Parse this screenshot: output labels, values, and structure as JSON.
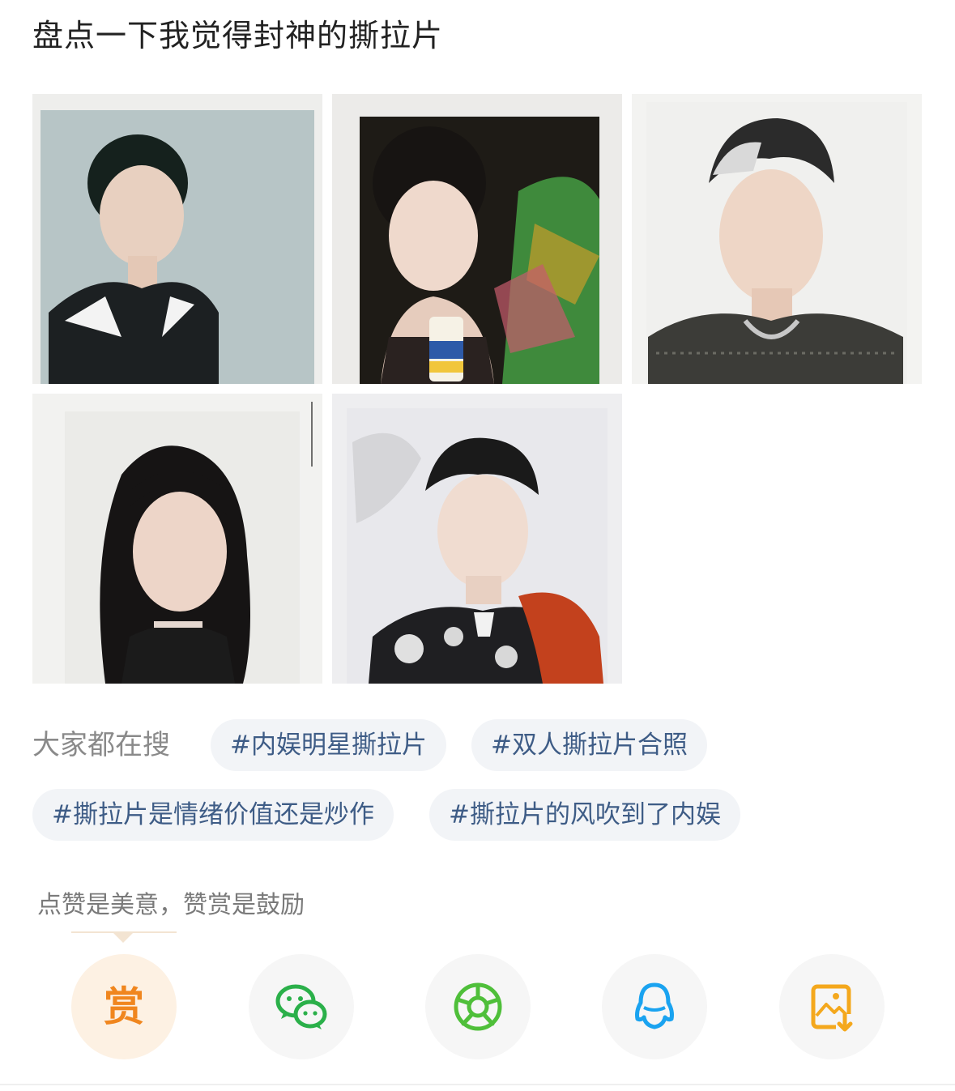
{
  "post": {
    "title": "盘点一下我觉得封神的撕拉片"
  },
  "photos": [
    {
      "icon": "polaroid-photo-man-black-jacket"
    },
    {
      "icon": "polaroid-photo-woman-with-drink"
    },
    {
      "icon": "polaroid-photo-man-silver-hair"
    },
    {
      "icon": "polaroid-photo-woman-long-hair"
    },
    {
      "icon": "polaroid-photo-boy-embroidered-jacket"
    }
  ],
  "hot_search": {
    "label": "大家都在搜",
    "tags": [
      "#内娱明星撕拉片",
      "#双人撕拉片合照",
      "#撕拉片是情绪价值还是炒作",
      "#撕拉片的风吹到了内娱"
    ]
  },
  "reward": {
    "hint": "点赞是美意，赞赏是鼓励",
    "button_label": "赏"
  },
  "share": [
    {
      "icon": "reward-icon"
    },
    {
      "icon": "wechat-icon"
    },
    {
      "icon": "moments-icon"
    },
    {
      "icon": "qq-icon"
    },
    {
      "icon": "save-image-icon"
    }
  ],
  "colors": {
    "tag_text": "#3e5c86",
    "tag_bg": "#f2f4f7",
    "reward_orange": "#f0861e",
    "wechat_green": "#2bb04a",
    "moments_green": "#4fbf3a",
    "qq_blue": "#1aa3f0",
    "save_orange": "#f4a81d"
  }
}
